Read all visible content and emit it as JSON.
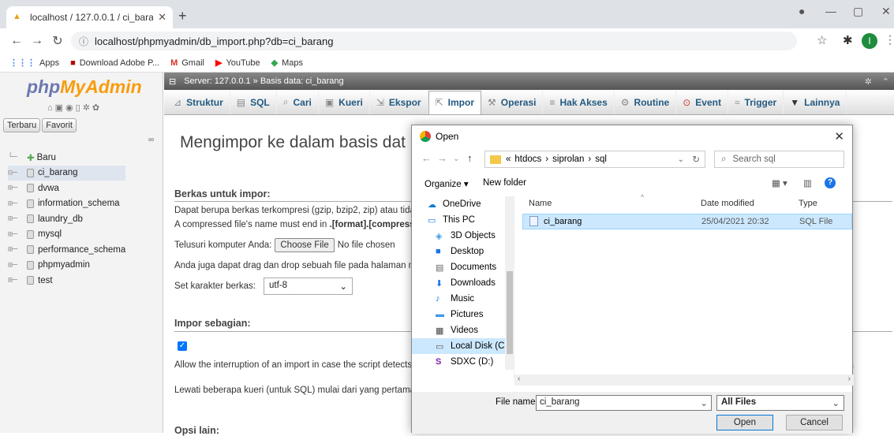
{
  "browser": {
    "tab_title": "localhost / 127.0.0.1 / ci_barang |",
    "url": "localhost/phpmyadmin/db_import.php?db=ci_barang",
    "profile_initial": "I",
    "bookmarks": [
      {
        "label": "Apps",
        "icon": "apps-icon",
        "color": "#4285f4"
      },
      {
        "label": "Download Adobe P...",
        "icon": "adobe-icon",
        "color": "#b30b00"
      },
      {
        "label": "Gmail",
        "icon": "gmail-icon",
        "color": "#d93025"
      },
      {
        "label": "YouTube",
        "icon": "youtube-icon",
        "color": "#ff0000"
      },
      {
        "label": "Maps",
        "icon": "maps-icon",
        "color": "#34a853"
      }
    ]
  },
  "pma": {
    "logo_a": "php",
    "logo_b": "MyAdmin",
    "recent": "Terbaru",
    "favorite": "Favorit",
    "tree": [
      {
        "label": "Baru",
        "selected": false
      },
      {
        "label": "ci_barang",
        "selected": true
      },
      {
        "label": "dvwa",
        "selected": false
      },
      {
        "label": "information_schema",
        "selected": false
      },
      {
        "label": "laundry_db",
        "selected": false
      },
      {
        "label": "mysql",
        "selected": false
      },
      {
        "label": "performance_schema",
        "selected": false
      },
      {
        "label": "phpmyadmin",
        "selected": false
      },
      {
        "label": "test",
        "selected": false
      }
    ],
    "breadcrumb": "Server: 127.0.0.1 » Basis data: ci_barang",
    "tabs": [
      {
        "label": "Struktur",
        "icon": "structure-icon"
      },
      {
        "label": "SQL",
        "icon": "sql-icon"
      },
      {
        "label": "Cari",
        "icon": "search-icon"
      },
      {
        "label": "Kueri",
        "icon": "query-icon"
      },
      {
        "label": "Ekspor",
        "icon": "export-icon"
      },
      {
        "label": "Impor",
        "icon": "import-icon",
        "active": true
      },
      {
        "label": "Operasi",
        "icon": "operations-icon"
      },
      {
        "label": "Hak Akses",
        "icon": "privileges-icon"
      },
      {
        "label": "Routine",
        "icon": "routines-icon"
      },
      {
        "label": "Event",
        "icon": "events-icon"
      },
      {
        "label": "Trigger",
        "icon": "triggers-icon"
      },
      {
        "label": "Lainnya",
        "icon": "more-icon"
      }
    ],
    "heading": "Mengimpor ke dalam basis dat",
    "file_section": "Berkas untuk impor:",
    "file_text_1": "Dapat berupa berkas terkompresi (gzip, bzip2, zip) atau tidak",
    "file_text_2a": "A compressed file's name must end in ",
    "file_text_2b": ".[format].[compressi",
    "browse_label": "Telusuri komputer Anda:",
    "choose_file": "Choose File",
    "no_file": "No file chosen",
    "drag_text": "Anda juga dapat drag dan drop sebuah file pada halaman ma",
    "charset_label": "Set karakter berkas:",
    "charset_value": "utf-8",
    "partial_section": "Impor sebagian:",
    "allow_text": "Allow the interruption of an import in case the script detects it",
    "paren_tail": ")",
    "skip_text": "Lewati beberapa kueri (untuk SQL) mulai dari yang pertama:",
    "other_section": "Opsi lain:"
  },
  "dialog": {
    "title": "Open",
    "path": [
      "«",
      "htdocs",
      "›",
      "siprolan",
      "›",
      "sql"
    ],
    "search_placeholder": "Search sql",
    "organize": "Organize ▾",
    "new_folder": "New folder",
    "nav": [
      {
        "label": "OneDrive",
        "icon": "onedrive-icon",
        "selected": false
      },
      {
        "label": "This PC",
        "icon": "pc-icon",
        "selected": false
      },
      {
        "label": "3D Objects",
        "icon": "3d-icon",
        "selected": false
      },
      {
        "label": "Desktop",
        "icon": "desktop-icon",
        "selected": false
      },
      {
        "label": "Documents",
        "icon": "documents-icon",
        "selected": false
      },
      {
        "label": "Downloads",
        "icon": "downloads-icon",
        "selected": false
      },
      {
        "label": "Music",
        "icon": "music-icon",
        "selected": false
      },
      {
        "label": "Pictures",
        "icon": "pictures-icon",
        "selected": false
      },
      {
        "label": "Videos",
        "icon": "videos-icon",
        "selected": false
      },
      {
        "label": "Local Disk (C:)",
        "icon": "disk-icon",
        "selected": true
      },
      {
        "label": "SDXC (D:)",
        "icon": "sd-icon",
        "selected": false
      }
    ],
    "columns": {
      "name": "Name",
      "date": "Date modified",
      "type": "Type"
    },
    "file": {
      "name": "ci_barang",
      "date": "25/04/2021 20:32",
      "type": "SQL File"
    },
    "filename_label": "File name:",
    "filename_value": "ci_barang",
    "filetype": "All Files",
    "open_btn": "Open",
    "cancel_btn": "Cancel"
  }
}
